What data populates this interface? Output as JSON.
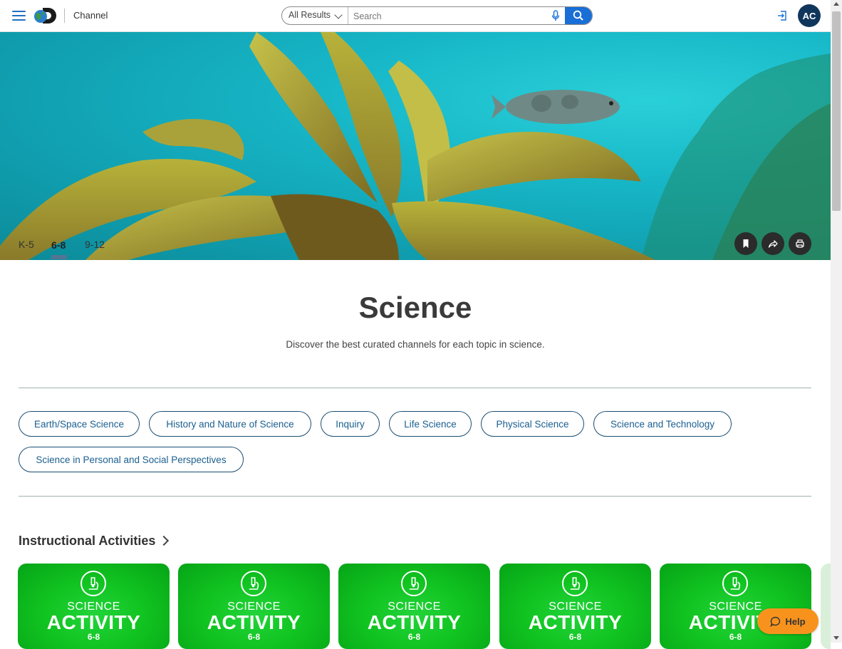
{
  "header": {
    "menu_icon": "hamburger-menu-icon",
    "logo_icon": "discovery-logo-icon",
    "page_label": "Channel",
    "search": {
      "scope": "All Results",
      "placeholder": "Search",
      "value": ""
    },
    "avatar_initials": "AC"
  },
  "grade_tabs": [
    {
      "label": "K-5",
      "active": false
    },
    {
      "label": "6-8",
      "active": true
    },
    {
      "label": "9-12",
      "active": false
    }
  ],
  "hero_actions": [
    "bookmark-icon",
    "share-icon",
    "print-icon"
  ],
  "page": {
    "title": "Science",
    "subtitle": "Discover the best curated channels for each topic in science."
  },
  "topics": [
    "Earth/Space Science",
    "History and Nature of Science",
    "Inquiry",
    "Life Science",
    "Physical Science",
    "Science and Technology",
    "Science in Personal and Social Perspectives"
  ],
  "section": {
    "title": "Instructional Activities"
  },
  "cards": [
    {
      "line1": "SCIENCE",
      "line2": "ACTIVITY",
      "line3": "6-8"
    },
    {
      "line1": "SCIENCE",
      "line2": "ACTIVITY",
      "line3": "6-8"
    },
    {
      "line1": "SCIENCE",
      "line2": "ACTIVITY",
      "line3": "6-8"
    },
    {
      "line1": "SCIENCE",
      "line2": "ACTIVITY",
      "line3": "6-8"
    },
    {
      "line1": "SCIENCE",
      "line2": "ACTIVITY",
      "line3": "6-8"
    }
  ],
  "help_button": "Help",
  "colors": {
    "accent_blue": "#1a6fd6",
    "avatar_navy": "#10365b",
    "pill_border": "#1b4e73",
    "card_green": "#11c421",
    "help_orange": "#f7931d"
  }
}
